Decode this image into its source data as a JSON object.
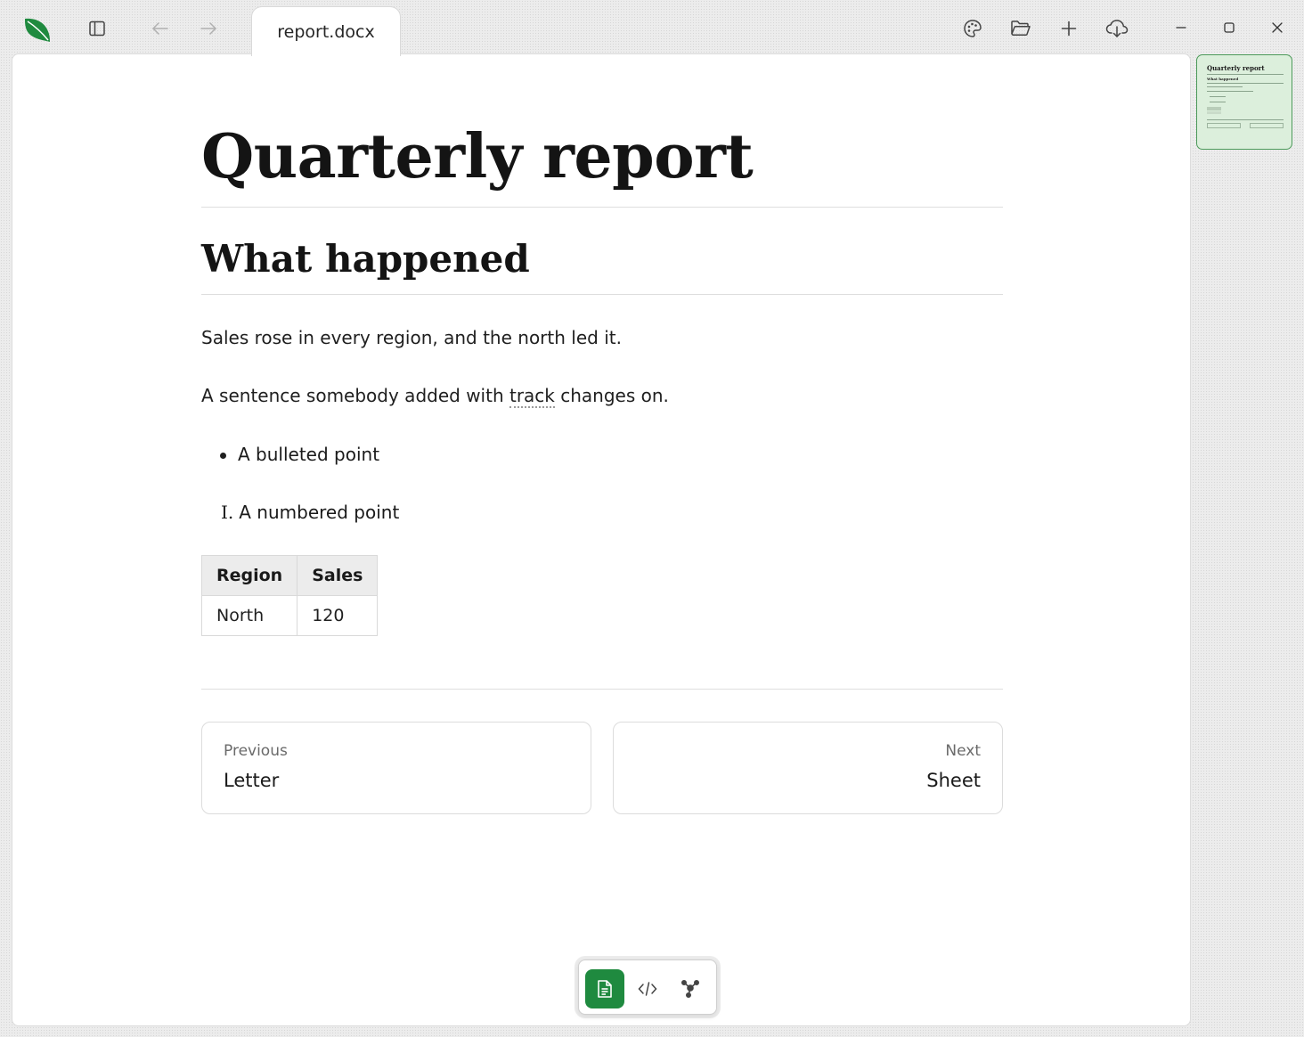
{
  "window": {
    "tab_label": "report.docx",
    "accent_color": "#1f8a3f"
  },
  "icons": {
    "logo": "leaf-logo-icon",
    "sidebar": "sidebar-toggle-icon",
    "back": "arrow-left-icon",
    "forward": "arrow-right-icon",
    "theme": "palette-icon",
    "open": "folder-open-icon",
    "new": "plus-icon",
    "download": "cloud-download-icon",
    "minimize": "minimize-icon",
    "maximize": "maximize-icon",
    "close": "close-icon"
  },
  "document": {
    "title": "Quarterly report",
    "heading": "What happened",
    "paragraph_1": "Sales rose in every region, and the north led it.",
    "paragraph_2_before": "A sentence somebody added with ",
    "paragraph_2_tracked": "track",
    "paragraph_2_after": " changes on.",
    "bullet_item": "A bulleted point",
    "numbered_marker": "I.",
    "numbered_item": "A numbered point",
    "table": {
      "headers": [
        "Region",
        "Sales"
      ],
      "rows": [
        [
          "North",
          "120"
        ]
      ]
    }
  },
  "pager": {
    "previous_label": "Previous",
    "previous_title": "Letter",
    "next_label": "Next",
    "next_title": "Sheet"
  },
  "view_switcher": {
    "active": "document",
    "items": [
      "document-icon",
      "code-icon",
      "graph-icon"
    ]
  },
  "minimap": {
    "title": "Quarterly report",
    "heading": "What happened"
  }
}
